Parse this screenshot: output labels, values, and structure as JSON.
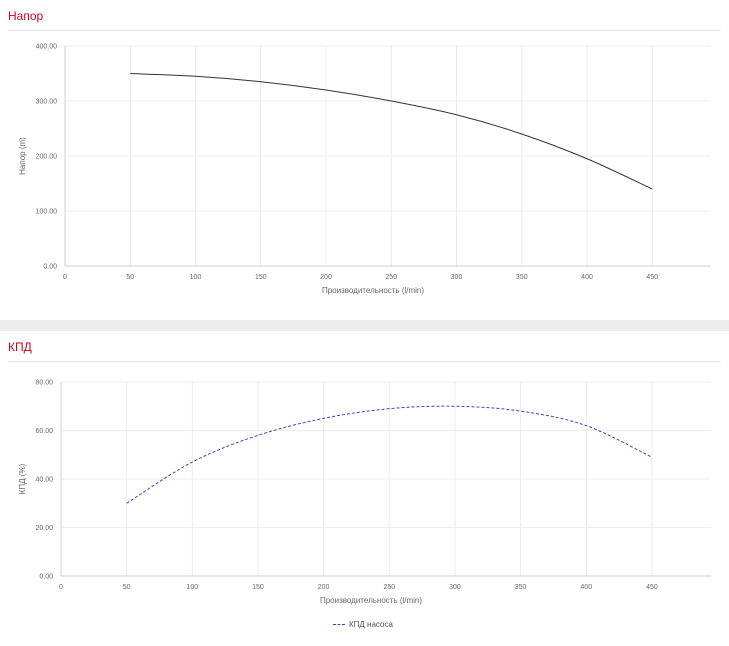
{
  "panels": {
    "head": {
      "title": "Напор"
    },
    "efficiency": {
      "title": "КПД"
    }
  },
  "chart_data": [
    {
      "type": "line",
      "title": "Напор",
      "xlabel": "Производительность (l/min)",
      "ylabel": "Напор (m)",
      "xlim": [
        0,
        495
      ],
      "ylim": [
        0,
        400
      ],
      "x_ticks": [
        "0",
        "50",
        "100",
        "150",
        "200",
        "250",
        "300",
        "350",
        "400",
        "450"
      ],
      "y_ticks": [
        "0.00",
        "100.00",
        "200.00",
        "300.00",
        "400.00"
      ],
      "grid": true,
      "legend": "none",
      "series": [
        {
          "color": "#333333",
          "dash": false,
          "x": [
            50,
            100,
            150,
            200,
            250,
            300,
            350,
            400,
            450
          ],
          "y": [
            350,
            345,
            335,
            320,
            300,
            275,
            240,
            195,
            140
          ]
        }
      ]
    },
    {
      "type": "line",
      "title": "КПД",
      "xlabel": "Производительность (l/min)",
      "ylabel": "КПД (%)",
      "xlim": [
        0,
        495
      ],
      "ylim": [
        0,
        80
      ],
      "x_ticks": [
        "0",
        "50",
        "100",
        "150",
        "200",
        "250",
        "300",
        "350",
        "400",
        "450"
      ],
      "y_ticks": [
        "0.00",
        "20.00",
        "40.00",
        "60.00",
        "80.00"
      ],
      "grid": true,
      "legend": "bottom-center",
      "series": [
        {
          "name": "КПД насоса",
          "color": "#3d3dd6",
          "dash": true,
          "x": [
            50,
            100,
            150,
            200,
            250,
            300,
            350,
            400,
            450
          ],
          "y": [
            30,
            47,
            58,
            65,
            69,
            70,
            68,
            62,
            49
          ]
        }
      ]
    }
  ]
}
